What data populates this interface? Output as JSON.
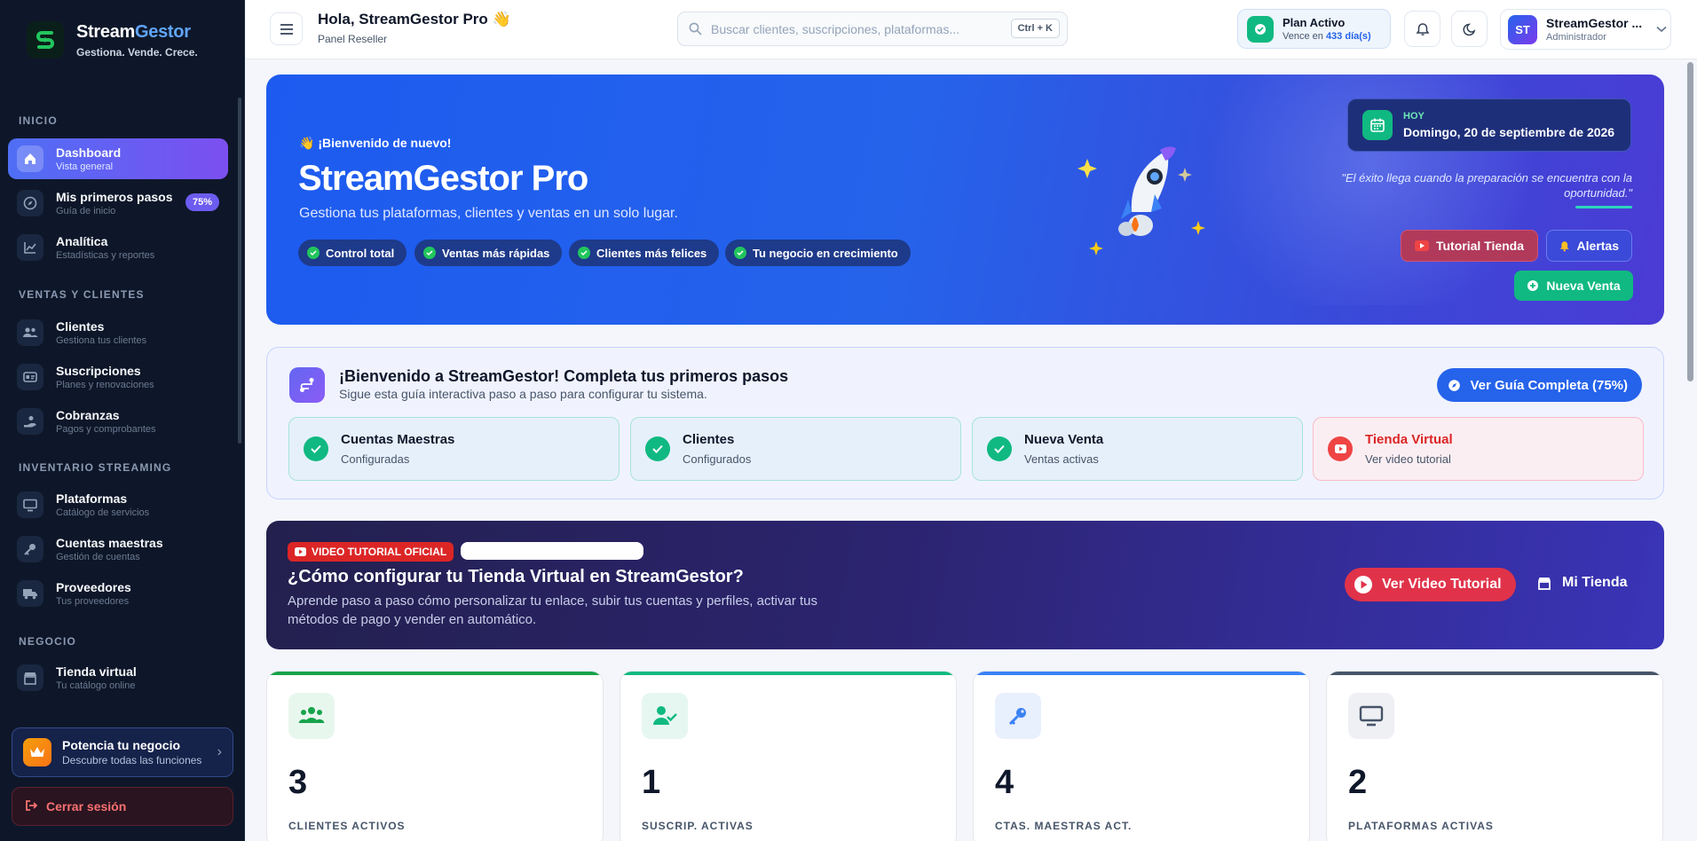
{
  "brand": {
    "name_main": "Stream",
    "name_accent": "Gestor",
    "tagline": "Gestiona. Vende. Crece."
  },
  "sidebar": {
    "sections": [
      "INICIO",
      "VENTAS Y CLIENTES",
      "INVENTARIO STREAMING",
      "NEGOCIO"
    ],
    "items": [
      {
        "label": "Dashboard",
        "sub": "Vista general",
        "icon": "home-icon",
        "active": true
      },
      {
        "label": "Mis primeros pasos",
        "sub": "Guía de inicio",
        "icon": "compass-icon",
        "badge": "75%"
      },
      {
        "label": "Analítica",
        "sub": "Estadísticas y reportes",
        "icon": "chart-icon"
      },
      {
        "label": "Clientes",
        "sub": "Gestiona tus clientes",
        "icon": "users-icon"
      },
      {
        "label": "Suscripciones",
        "sub": "Planes y renovaciones",
        "icon": "id-card-icon"
      },
      {
        "label": "Cobranzas",
        "sub": "Pagos y comprobantes",
        "icon": "hand-coin-icon"
      },
      {
        "label": "Plataformas",
        "sub": "Catálogo de servicios",
        "icon": "monitor-icon"
      },
      {
        "label": "Cuentas maestras",
        "sub": "Gestión de cuentas",
        "icon": "key-icon"
      },
      {
        "label": "Proveedores",
        "sub": "Tus proveedores",
        "icon": "truck-icon"
      },
      {
        "label": "Tienda virtual",
        "sub": "Tu catálogo online",
        "icon": "store-icon"
      }
    ],
    "promo": {
      "title": "Potencia tu negocio",
      "sub": "Descubre todas las funciones"
    },
    "logout": "Cerrar sesión"
  },
  "topbar": {
    "greeting": "Hola, StreamGestor Pro 👋",
    "subtitle": "Panel Reseller",
    "search_placeholder": "Buscar clientes, suscripciones, plataformas...",
    "search_shortcut": "Ctrl + K",
    "plan_title": "Plan Activo",
    "plan_prefix": "Vence en",
    "plan_days": "433 día(s)",
    "user_initials": "ST",
    "user_name": "StreamGestor ...",
    "user_role": "Administrador"
  },
  "hero": {
    "welcome": "👋 ¡Bienvenido de nuevo!",
    "title": "StreamGestor Pro",
    "subtitle": "Gestiona tus plataformas, clientes y ventas en un solo lugar.",
    "pills": [
      "Control total",
      "Ventas más rápidas",
      "Clientes más felices",
      "Tu negocio en crecimiento"
    ],
    "date_label": "HOY",
    "date_value": "Domingo, 20 de septiembre de 2026",
    "quote": "\"El éxito llega cuando la preparación se encuentra con la oportunidad.\"",
    "btn_tutorial": "Tutorial Tienda",
    "btn_alerts": "Alertas",
    "btn_new_sale": "Nueva Venta"
  },
  "guide": {
    "title": "¡Bienvenido a StreamGestor! Completa tus primeros pasos",
    "subtitle": "Sigue esta guía interactiva paso a paso para configurar tu sistema.",
    "button": "Ver Guía Completa (75%)",
    "steps": [
      {
        "title": "Cuentas Maestras",
        "sub": "Configuradas",
        "done": true
      },
      {
        "title": "Clientes",
        "sub": "Configurados",
        "done": true
      },
      {
        "title": "Nueva Venta",
        "sub": "Ventas activas",
        "done": true
      },
      {
        "title": "Tienda Virtual",
        "sub": "Ver video tutorial",
        "done": false
      }
    ]
  },
  "video": {
    "badge": "VIDEO TUTORIAL OFICIAL",
    "title": "¿Cómo configurar tu Tienda Virtual en StreamGestor?",
    "subtitle": "Aprende paso a paso cómo personalizar tu enlace, subir tus cuentas y perfiles, activar tus métodos de pago y vender en automático.",
    "btn_watch": "Ver Video Tutorial",
    "link_store": "Mi Tienda"
  },
  "stats": [
    {
      "value": "3",
      "label": "CLIENTES ACTIVOS",
      "icon": "users-icon",
      "accent": "#16a34a"
    },
    {
      "value": "1",
      "label": "SUSCRIP. ACTIVAS",
      "icon": "user-check-icon",
      "accent": "#10b981"
    },
    {
      "value": "4",
      "label": "CTAS. MAESTRAS ACT.",
      "icon": "key-icon",
      "accent": "#3b82f6"
    },
    {
      "value": "2",
      "label": "PLATAFORMAS ACTIVAS",
      "icon": "monitor-icon",
      "accent": "#475569"
    }
  ]
}
